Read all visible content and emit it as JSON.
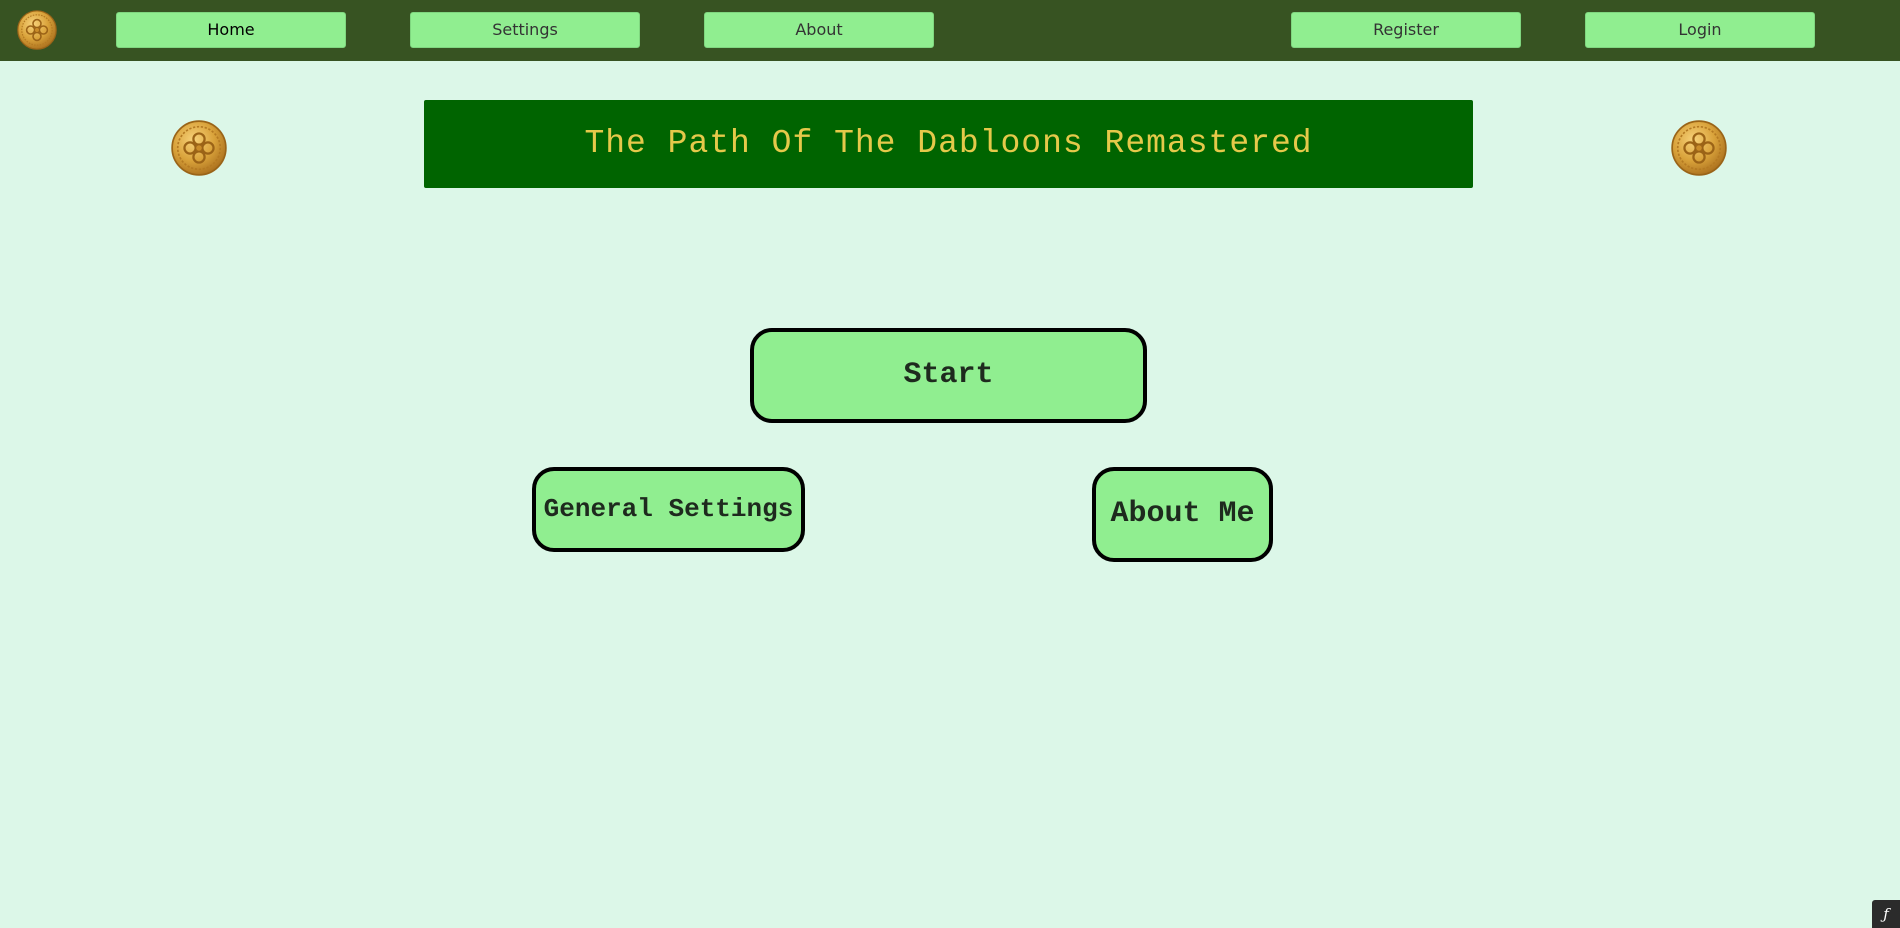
{
  "navbar": {
    "items": [
      {
        "label": "Home",
        "active": true
      },
      {
        "label": "Settings",
        "active": false
      },
      {
        "label": "About",
        "active": false
      }
    ],
    "auth": {
      "register_label": "Register",
      "login_label": "Login"
    },
    "logo_icon": "gold-coin-icon"
  },
  "header": {
    "title": "The Path Of The Dabloons Remastered",
    "decor_icon": "gold-coin-icon"
  },
  "menu": {
    "start_label": "Start",
    "general_settings_label": "General Settings",
    "about_me_label": "About Me"
  },
  "colors": {
    "navbar_bg": "#375322",
    "page_bg": "#dcf7e8",
    "button_bg": "#90ee90",
    "banner_bg": "#006400",
    "banner_text": "#e5c94a"
  },
  "corner_badge": {
    "icon": "debug-toolbar-icon",
    "glyph": "ƒ"
  }
}
